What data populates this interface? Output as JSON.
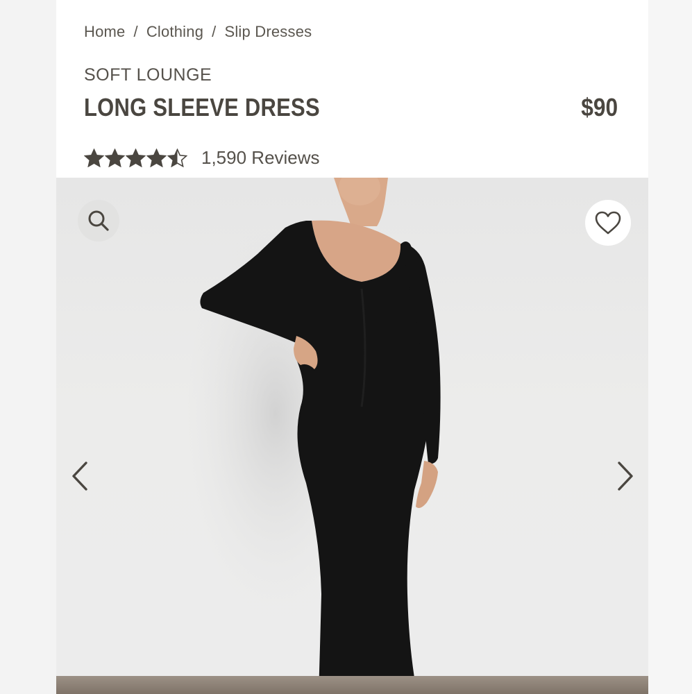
{
  "breadcrumb": {
    "items": [
      "Home",
      "Clothing",
      "Slip Dresses"
    ],
    "separator": "/"
  },
  "product": {
    "brand": "SOFT LOUNGE",
    "title": "LONG SLEEVE DRESS",
    "price": "$90",
    "rating": {
      "value": 4.5,
      "max": 5,
      "reviews_label": "1,590 Reviews"
    }
  },
  "gallery": {
    "icons": {
      "zoom": "search-icon",
      "wishlist": "heart-icon",
      "previous": "chevron-left-icon",
      "next": "chevron-right-icon"
    }
  },
  "colors": {
    "text": "#4a4640",
    "star": "#4a4640",
    "dress": "#121212",
    "backdrop": "#e9e9e9"
  }
}
